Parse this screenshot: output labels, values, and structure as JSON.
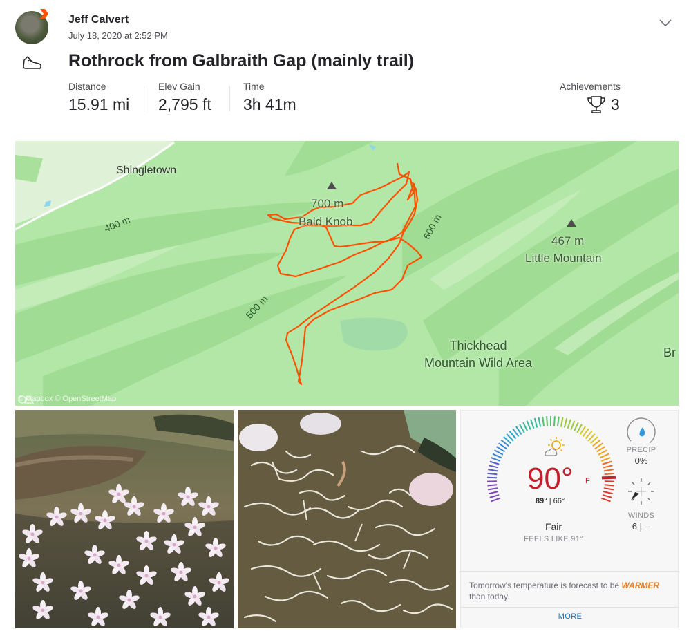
{
  "athlete": {
    "name": "Jeff Calvert",
    "timestamp": "July 18, 2020 at 2:52 PM"
  },
  "activity": {
    "sport_icon": "shoe-icon",
    "title": "Rothrock from Galbraith Gap (mainly trail)"
  },
  "stats": [
    {
      "label": "Distance",
      "value": "15.91 mi"
    },
    {
      "label": "Elev Gain",
      "value": "2,795 ft"
    },
    {
      "label": "Time",
      "value": "3h 41m"
    }
  ],
  "achievements": {
    "label": "Achievements",
    "count": "3",
    "icon": "trophy-icon"
  },
  "map": {
    "labels": {
      "town": "Shingletown",
      "peak1_elev": "700 m",
      "peak1_name": "Bald Knob",
      "peak2_elev": "467 m",
      "peak2_name": "Little Mountain",
      "wild_area_line1": "Thickhead",
      "wild_area_line2": "Mountain Wild Area",
      "edge_label": "Br",
      "contour_400": "400 m",
      "contour_500": "500 m",
      "contour_600": "600 m"
    },
    "attribution": "© Mapbox © OpenStreetMap",
    "route_color": "#fc5200",
    "land_color": "#b3e7a8"
  },
  "weather": {
    "temperature": "90°",
    "unit": "F",
    "high": "89°",
    "low": "66°",
    "condition": "Fair",
    "feels_like": "FEELS LIKE 91°",
    "precip_label": "PRECIP",
    "precip_value": "0%",
    "winds_label": "WINDS",
    "winds_value": "6 | --",
    "forecast_prefix": "Tomorrow's temperature is forecast to be",
    "forecast_highlight": "WARMER",
    "forecast_suffix": "than today.",
    "more_label": "MORE",
    "temp_color": "#c2202b",
    "highlight_color": "#e8822b"
  }
}
